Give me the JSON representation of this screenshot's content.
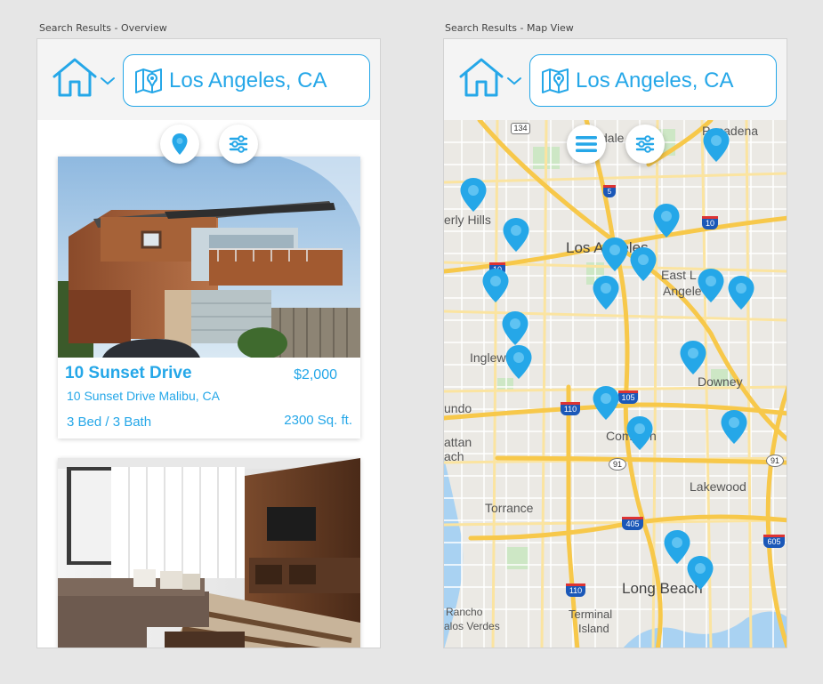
{
  "artboards": {
    "overview_label": "Search Results - Overview",
    "map_label": "Search Results - Map View"
  },
  "header": {
    "location": "Los Angeles, CA",
    "home_icon": "home-icon",
    "map_icon": "map-pin-icon",
    "accent_color": "#25a7e8"
  },
  "listings": [
    {
      "title": "10 Sunset Drive",
      "price": "$2,000",
      "address": "10 Sunset Drive Malibu, CA",
      "beds_baths": "3 Bed / 3 Bath",
      "sqft": "2300 Sq. ft."
    }
  ],
  "map": {
    "labels": {
      "glendale": "dale",
      "pasadena": "Pasadena",
      "beverly_hills": "erly Hills",
      "los_angeles": "Los Angeles",
      "east_la_1": "East L",
      "east_la_2": "Angele",
      "inglewood": "Inglew",
      "downey": "Downey",
      "gundo": "undo",
      "compton": "Compton",
      "manhattan_1": "attan",
      "manhattan_2": "ach",
      "lakewood": "Lakewood",
      "torrance": "Torrance",
      "long_beach": "Long Beach",
      "rancho_1": "Rancho",
      "rancho_2": "alos Verdes",
      "terminal_1": "Terminal",
      "terminal_2": "Island"
    },
    "shields": {
      "r134": "134",
      "r5": "5",
      "r10a": "10",
      "r10b": "10",
      "r105": "105",
      "r110a": "110",
      "r110b": "110",
      "r91a": "91",
      "r91b": "91",
      "r405": "405",
      "r605": "605"
    }
  }
}
